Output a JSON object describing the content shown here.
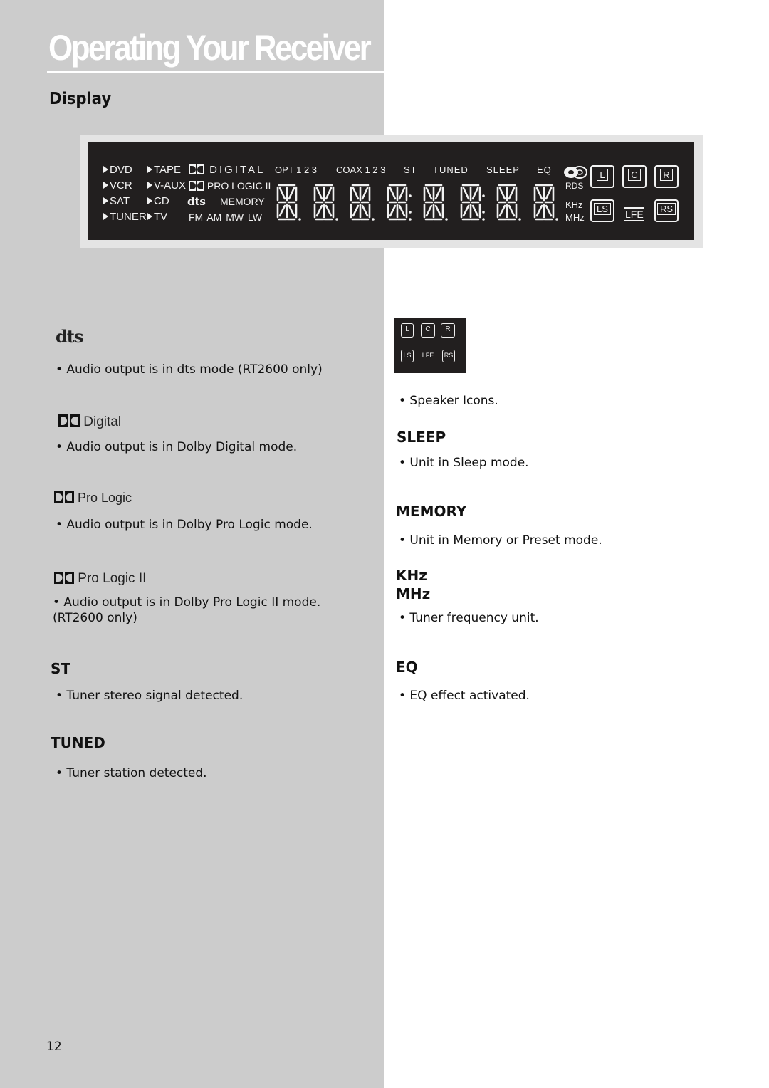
{
  "page": {
    "title": "Operating Your Receiver",
    "section": "Display",
    "page_number": "12"
  },
  "display_panel": {
    "sources_col1": [
      "DVD",
      "VCR",
      "SAT",
      "TUNER"
    ],
    "sources_col2": [
      "TAPE",
      "V-AUX",
      "CD",
      "TV"
    ],
    "dolby_digital": "DIGITAL",
    "pro_logic": "PRO LOGIC II",
    "dts": "dts",
    "memory": "MEMORY",
    "bands": "FM AM MW LW",
    "top_indicators": [
      "OPT 1 2 3",
      "COAX 1 2 3",
      "ST",
      "TUNED",
      "SLEEP",
      "EQ"
    ],
    "rds": "RDS",
    "khz": "KHz",
    "mhz": "MHz",
    "speakers_top": [
      "L",
      "C",
      "R"
    ],
    "speakers_bottom": [
      "LS",
      "LFE",
      "RS"
    ],
    "digit_count": "8"
  },
  "left_column": [
    {
      "heading": "dts",
      "text": "• Audio output is in dts mode (RT2600 only)"
    },
    {
      "heading": "Digital",
      "text": "•  Audio output is in Dolby Digital mode."
    },
    {
      "heading": "Pro Logic",
      "text": "•  Audio output is in Dolby Pro Logic mode."
    },
    {
      "heading": "Pro Logic II",
      "text": " • Audio output is in Dolby Pro Logic II mode.",
      "text2": "(RT2600 only)"
    },
    {
      "heading": "ST",
      "text": "•  Tuner stereo signal detected."
    },
    {
      "heading": "TUNED",
      "text": "•  Tuner station detected."
    }
  ],
  "right_column": [
    {
      "heading": "",
      "text": "•  Speaker Icons."
    },
    {
      "heading": "SLEEP",
      "text": "•  Unit in Sleep mode."
    },
    {
      "heading": "MEMORY",
      "text": "•  Unit in Memory or Preset mode."
    },
    {
      "heading": "KHz",
      "heading2": "MHz",
      "text": "• Tuner frequency unit."
    },
    {
      "heading": "EQ",
      "text": "• EQ effect activated."
    }
  ],
  "mini_speakers": {
    "top": [
      "L",
      "C",
      "R"
    ],
    "bottom": [
      "LS",
      "LFE",
      "RS"
    ]
  }
}
